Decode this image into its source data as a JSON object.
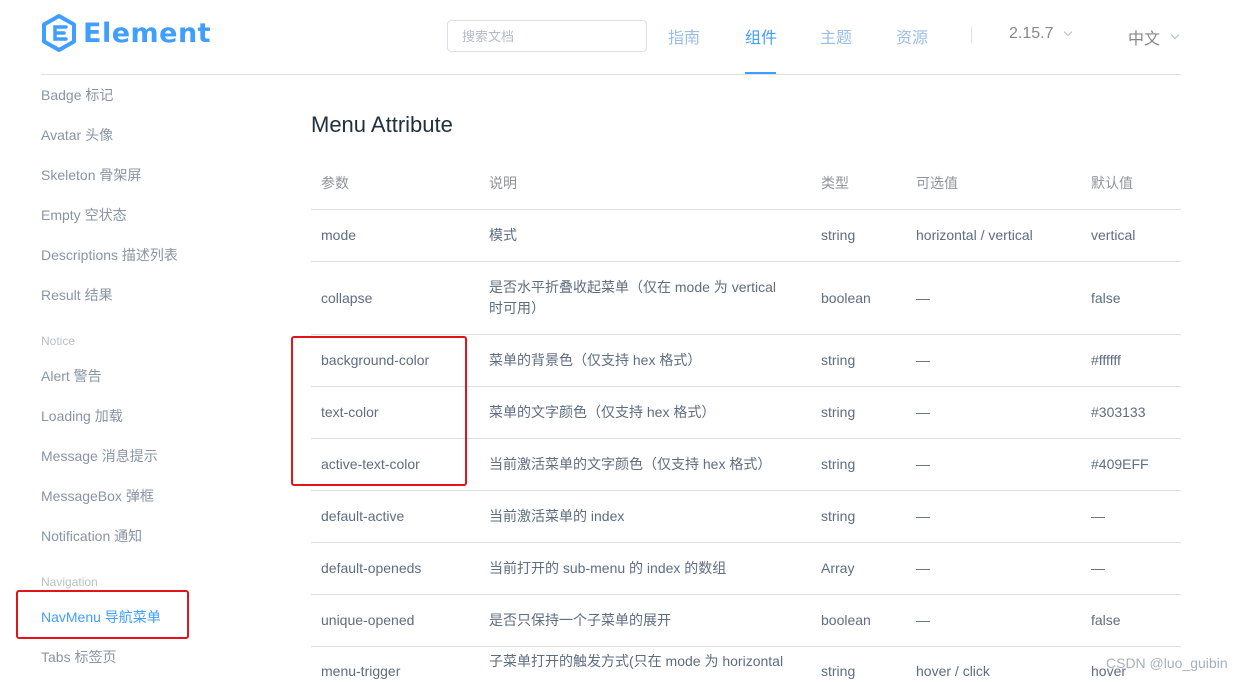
{
  "header": {
    "logo_text": "Element",
    "search_placeholder": "搜索文档",
    "nav": [
      {
        "label": "指南",
        "active": false
      },
      {
        "label": "组件",
        "active": true
      },
      {
        "label": "主题",
        "active": false
      },
      {
        "label": "资源",
        "active": false
      }
    ],
    "version": "2.15.7",
    "language": "中文",
    "colors": {
      "accent": "#409EFF",
      "nav_inactive": "#99BEE8"
    }
  },
  "sidebar": {
    "items": [
      {
        "label": "Badge 标记"
      },
      {
        "label": "Avatar 头像"
      },
      {
        "label": "Skeleton 骨架屏"
      },
      {
        "label": "Empty 空状态"
      },
      {
        "label": "Descriptions 描述列表"
      },
      {
        "label": "Result 结果"
      },
      {
        "group": "Notice"
      },
      {
        "label": "Alert 警告"
      },
      {
        "label": "Loading 加载"
      },
      {
        "label": "Message 消息提示"
      },
      {
        "label": "MessageBox 弹框"
      },
      {
        "label": "Notification 通知"
      },
      {
        "group": "Navigation"
      },
      {
        "label": "NavMenu 导航菜单",
        "active": true
      },
      {
        "label": "Tabs 标签页"
      }
    ]
  },
  "main": {
    "title": "Menu Attribute",
    "table": {
      "headers": [
        "参数",
        "说明",
        "类型",
        "可选值",
        "默认值"
      ],
      "rows": [
        [
          "mode",
          "模式",
          "string",
          "horizontal / vertical",
          "vertical"
        ],
        [
          "collapse",
          "是否水平折叠收起菜单（仅在 mode 为 vertical 时可用）",
          "boolean",
          "—",
          "false"
        ],
        [
          "background-color",
          "菜单的背景色（仅支持 hex 格式）",
          "string",
          "—",
          "#ffffff"
        ],
        [
          "text-color",
          "菜单的文字颜色（仅支持 hex 格式）",
          "string",
          "—",
          "#303133"
        ],
        [
          "active-text-color",
          "当前激活菜单的文字颜色（仅支持 hex 格式）",
          "string",
          "—",
          "#409EFF"
        ],
        [
          "default-active",
          "当前激活菜单的 index",
          "string",
          "—",
          "—"
        ],
        [
          "default-openeds",
          "当前打开的 sub-menu 的 index 的数组",
          "Array",
          "—",
          "—"
        ],
        [
          "unique-opened",
          "是否只保持一个子菜单的展开",
          "boolean",
          "—",
          "false"
        ],
        [
          "menu-trigger",
          "子菜单打开的触发方式(只在 mode 为 horizontal",
          "string",
          "hover / click",
          "hover"
        ]
      ]
    }
  },
  "annotation_color": "#E0141A",
  "watermark": "CSDN @luo_guibin"
}
